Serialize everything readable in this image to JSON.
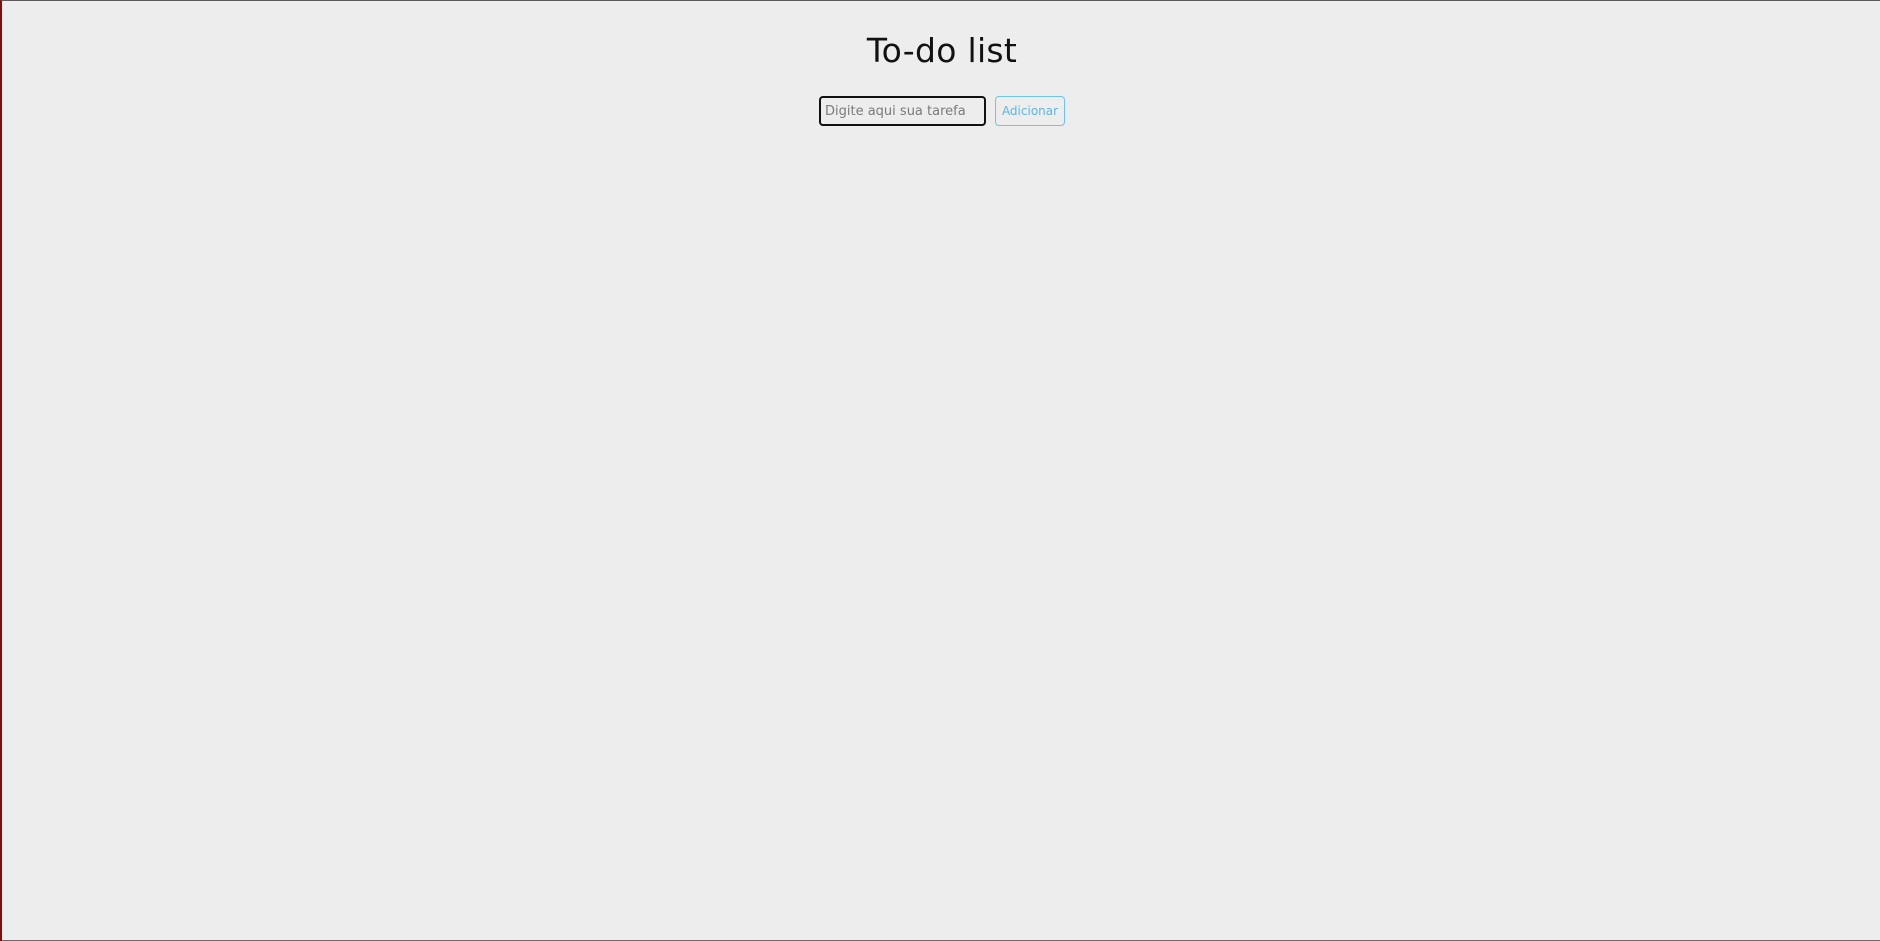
{
  "app": {
    "title": "To-do list"
  },
  "form": {
    "input_placeholder": "Digite aqui sua tarefa",
    "input_value": "",
    "add_button_label": "Adicionar"
  },
  "colors": {
    "background": "#ededed",
    "accent": "#58b8e6",
    "text": "#111111"
  },
  "tasks": []
}
